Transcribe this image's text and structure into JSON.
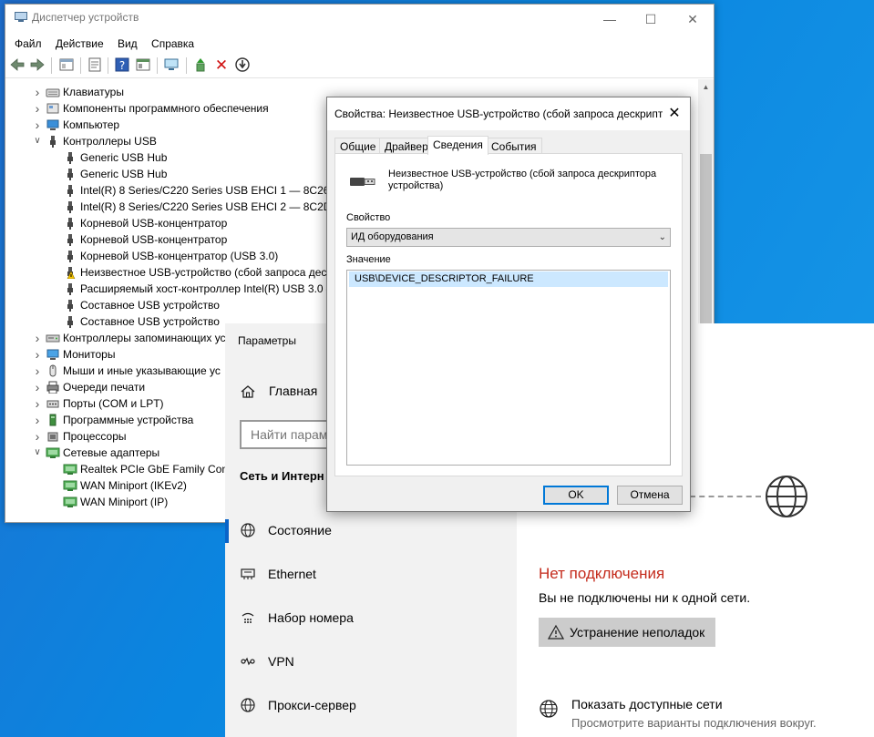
{
  "device_manager": {
    "title": "Диспетчер устройств",
    "menu": [
      "Файл",
      "Действие",
      "Вид",
      "Справка"
    ],
    "toolbar_icons": [
      "back-icon",
      "forward-icon",
      "properties-icon",
      "details-icon",
      "help-icon",
      "view-icon",
      "monitor-icon",
      "update-driver-icon",
      "uninstall-icon",
      "disable-icon"
    ],
    "tree": [
      {
        "label": "Клавиатуры",
        "level": 0,
        "expanded": false,
        "icon": "keyboard-icon"
      },
      {
        "label": "Компоненты программного обеспечения",
        "level": 0,
        "expanded": false,
        "icon": "component-icon"
      },
      {
        "label": "Компьютер",
        "level": 0,
        "expanded": false,
        "icon": "computer-icon"
      },
      {
        "label": "Контроллеры USB",
        "level": 0,
        "expanded": true,
        "icon": "usb-icon"
      },
      {
        "label": "Generic USB Hub",
        "level": 1,
        "icon": "usb-icon"
      },
      {
        "label": "Generic USB Hub",
        "level": 1,
        "icon": "usb-icon"
      },
      {
        "label": "Intel(R) 8 Series/C220 Series USB EHCI 1 — 8C26",
        "level": 1,
        "icon": "usb-icon"
      },
      {
        "label": "Intel(R) 8 Series/C220 Series USB EHCI 2 — 8C2D",
        "level": 1,
        "icon": "usb-icon"
      },
      {
        "label": "Корневой USB-концентратор",
        "level": 1,
        "icon": "usb-icon"
      },
      {
        "label": "Корневой USB-концентратор",
        "level": 1,
        "icon": "usb-icon"
      },
      {
        "label": "Корневой USB-концентратор (USB 3.0)",
        "level": 1,
        "icon": "usb-icon"
      },
      {
        "label": "Неизвестное USB-устройство (сбой запроса деск",
        "level": 1,
        "icon": "warning-icon"
      },
      {
        "label": "Расширяемый хост-контроллер Intel(R) USB 3.0 —",
        "level": 1,
        "icon": "usb-icon"
      },
      {
        "label": "Составное USB устройство",
        "level": 1,
        "icon": "usb-icon"
      },
      {
        "label": "Составное USB устройство",
        "level": 1,
        "icon": "usb-icon"
      },
      {
        "label": "Контроллеры запоминающих ус",
        "level": 0,
        "expanded": false,
        "icon": "storage-icon"
      },
      {
        "label": "Мониторы",
        "level": 0,
        "expanded": false,
        "icon": "monitor-icon"
      },
      {
        "label": "Мыши и иные указывающие ус",
        "level": 0,
        "expanded": false,
        "icon": "mouse-icon"
      },
      {
        "label": "Очереди печати",
        "level": 0,
        "expanded": false,
        "icon": "printer-icon"
      },
      {
        "label": "Порты (COM и LPT)",
        "level": 0,
        "expanded": false,
        "icon": "port-icon"
      },
      {
        "label": "Программные устройства",
        "level": 0,
        "expanded": false,
        "icon": "software-device-icon"
      },
      {
        "label": "Процессоры",
        "level": 0,
        "expanded": false,
        "icon": "cpu-icon"
      },
      {
        "label": "Сетевые адаптеры",
        "level": 0,
        "expanded": true,
        "icon": "network-adapter-icon"
      },
      {
        "label": "Realtek PCIe GbE Family Contr",
        "level": 1,
        "icon": "network-adapter-icon"
      },
      {
        "label": "WAN Miniport (IKEv2)",
        "level": 1,
        "icon": "network-adapter-icon"
      },
      {
        "label": "WAN Miniport (IP)",
        "level": 1,
        "icon": "network-adapter-icon"
      }
    ]
  },
  "settings": {
    "title": "Параметры",
    "home": "Главная",
    "search_placeholder": "Найти парам",
    "section": "Сеть и Интерн",
    "nav": [
      {
        "label": "Состояние",
        "icon": "globe-icon",
        "active": true
      },
      {
        "label": "Ethernet",
        "icon": "ethernet-icon",
        "active": false
      },
      {
        "label": "Набор номера",
        "icon": "dialup-icon",
        "active": false
      },
      {
        "label": "VPN",
        "icon": "vpn-icon",
        "active": false
      },
      {
        "label": "Прокси-сервер",
        "icon": "globe-icon",
        "active": false
      }
    ],
    "status_title": "Нет подключения",
    "status_sub": "Вы не подключены ни к одной сети.",
    "troubleshoot": "Устранение неполадок",
    "show_networks": "Показать доступные сети",
    "show_networks_sub": "Просмотрите варианты подключения вокруг.",
    "error_color": "#c42b1c"
  },
  "properties": {
    "title": "Свойства: Неизвестное USB-устройство (сбой запроса дескрипто",
    "tabs": [
      "Общие",
      "Драйвер",
      "Сведения",
      "События"
    ],
    "active_tab": "Сведения",
    "device_name": "Неизвестное USB-устройство (сбой запроса дескриптора устройства)",
    "property_label": "Свойство",
    "property_value": "ИД оборудования",
    "value_label": "Значение",
    "values": [
      "USB\\DEVICE_DESCRIPTOR_FAILURE"
    ],
    "ok": "OK",
    "cancel": "Отмена"
  }
}
